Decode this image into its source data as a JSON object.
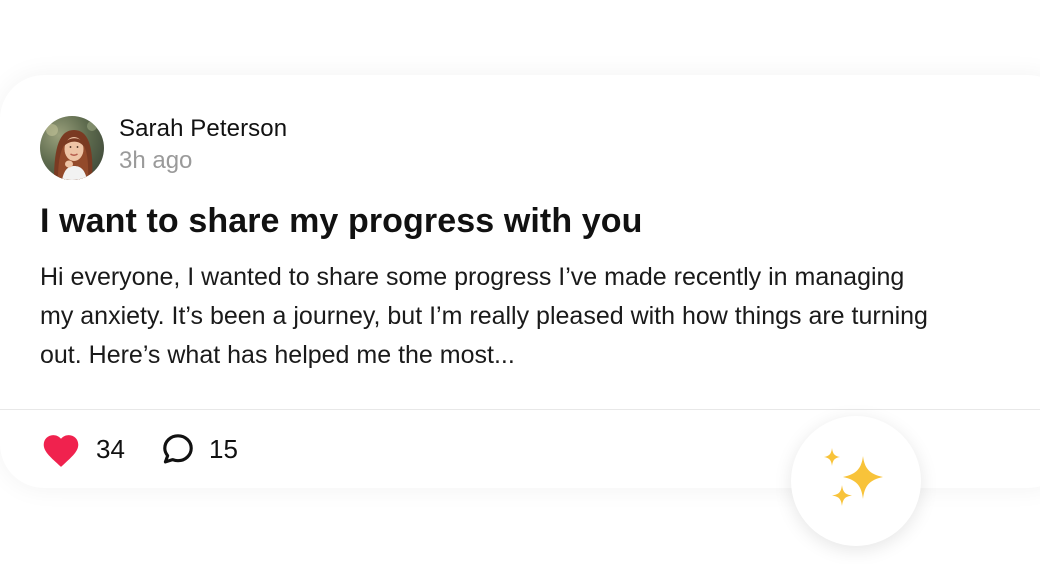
{
  "post": {
    "author": {
      "name": "Sarah Peterson",
      "timestamp": "3h ago",
      "avatar_icon": "user-photo-avatar"
    },
    "title": "I want to share my progress with you",
    "body": "Hi everyone, I wanted to share some progress I’ve made recently in managing my anxiety. It’s been a journey, but I’m really pleased with how things are turning out. Here’s what has helped me the most...",
    "likes": {
      "count": "34",
      "icon": "heart-icon",
      "color": "#F0224E"
    },
    "comments": {
      "count": "15",
      "icon": "speech-bubble-icon"
    }
  },
  "fab": {
    "icon": "sparkles-icon",
    "color": "#F8C33A"
  }
}
